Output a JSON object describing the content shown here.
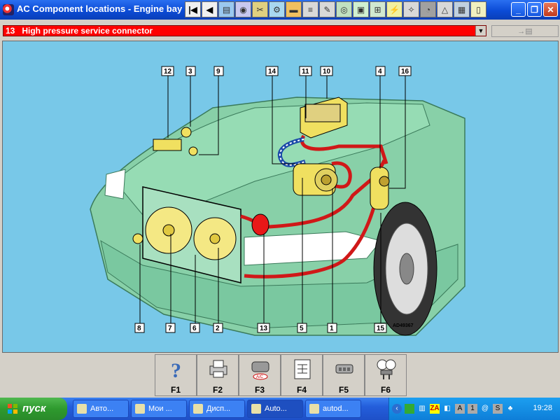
{
  "window": {
    "title": "AC Component locations - Engine bay"
  },
  "toolbar": {
    "icons": [
      "first-page-icon",
      "previous-page-icon",
      "manual-icon",
      "disc-icon",
      "tools-icon",
      "wrench-icon",
      "car-icon",
      "drawing-icon",
      "pen-icon",
      "sensor-icon",
      "panel-icon",
      "lift-icon",
      "bolt-icon",
      "spanner-icon",
      "gauge-icon",
      "warning-icon",
      "cpu-icon",
      "document-icon"
    ]
  },
  "selector": {
    "value": "13   High pressure service connector"
  },
  "diagram": {
    "labels": [
      "12",
      "3",
      "9",
      "14",
      "11",
      "10",
      "4",
      "16",
      "8",
      "7",
      "6",
      "2",
      "13",
      "5",
      "1",
      "15"
    ],
    "code": "AD49367"
  },
  "fkeys": [
    {
      "label": "F1",
      "icon": "help-question-icon"
    },
    {
      "label": "F2",
      "icon": "printer-icon"
    },
    {
      "label": "F3",
      "icon": "ac-compressor-icon"
    },
    {
      "label": "F4",
      "icon": "wiring-diagram-icon"
    },
    {
      "label": "F5",
      "icon": "connector-icon"
    },
    {
      "label": "F6",
      "icon": "pressure-gauges-icon"
    }
  ],
  "taskbar": {
    "start_label": "пуск",
    "tasks": [
      "Авто...",
      "Мои ...",
      "Дисп...",
      "Auto...",
      "autod..."
    ],
    "active_task": 3,
    "tray_icons": [
      "back-arrow-icon",
      "monitor-icon",
      "network-icon",
      "za-icon",
      "language-icon",
      "a-icon",
      "one-icon",
      "at-icon",
      "s-icon",
      "globe-icon"
    ],
    "clock": "19:28"
  },
  "colors": {
    "title_bar": "#0b4bd6",
    "selector_bg": "#ff0000",
    "diagram_bg": "#78c8e8",
    "car_body": "#88d0a8",
    "pipe": "#d01818",
    "component": "#f0e060"
  }
}
